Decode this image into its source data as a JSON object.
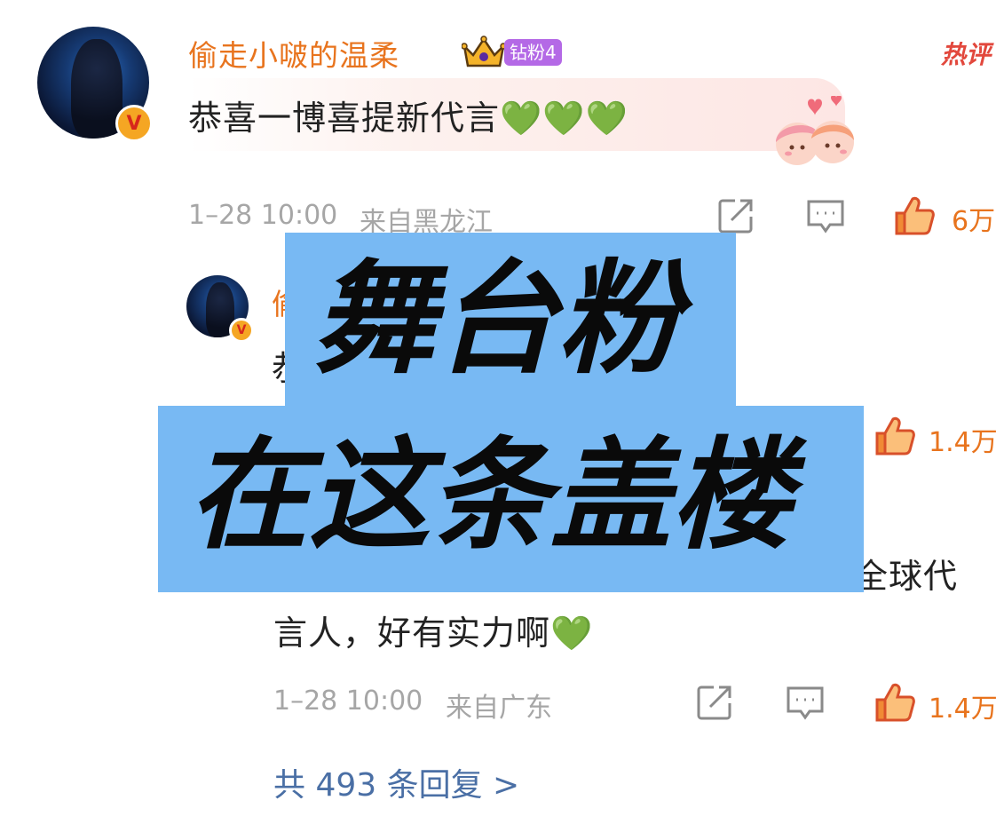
{
  "comment": {
    "username": "偷走小啵的温柔",
    "fan_badge": "钻粉4",
    "hot_tag": "热评",
    "text": "恭喜一博喜提新代言",
    "hearts": "💚💚💚",
    "timestamp": "1–28 10:00",
    "location": "来自黑龙江",
    "likes": "6万"
  },
  "reply": {
    "username_partial": "偷",
    "text_partial_1": "恭",
    "text_partial_2": "全球代",
    "text_line2": "言人，好有实力啊",
    "hearts": "💚",
    "mid_likes": "1.4万",
    "timestamp": "1–28 10:00",
    "location": "来自广东",
    "likes": "1.4万"
  },
  "replies_link": "共 493 条回复 >",
  "overlay": {
    "line1": "舞台粉",
    "line2": "在这条盖楼"
  },
  "colors": {
    "username": "#e8741e",
    "overlay_bg": "#78b9f3",
    "link": "#4a6fa5",
    "fan_badge": "#b469e6"
  },
  "icons": [
    "crown-icon",
    "share-icon",
    "comment-icon",
    "thumbs-up-icon",
    "verified-badge-icon"
  ]
}
